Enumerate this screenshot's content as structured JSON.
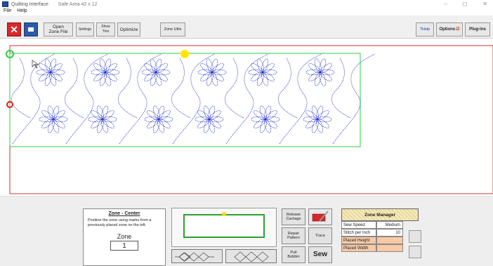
{
  "window": {
    "title": "Quilting Interface",
    "subtitle": "Safe Area 42 x 12",
    "min": "–",
    "max": "◻",
    "close": "✕"
  },
  "menu": [
    "File",
    "Help"
  ],
  "toolbar": {
    "close_glyph": "✕",
    "open_zone": "Open\nZone File",
    "settings": "Settings",
    "show_trim": "Show\nTrim",
    "optimize": "Optimize",
    "zone_utils": "Zone Utils",
    "help": "?Help",
    "options": "Options",
    "plugins": "Plug-ins"
  },
  "zone_info": {
    "title": "Zone - Center",
    "description": "Position the zone using marks from a previously placed zone on the left.",
    "zone_label": "Zone",
    "zone_value": "1"
  },
  "controls": {
    "release_carriage": "Release\nCarriage",
    "repair_pattern": "Repair\nPattern",
    "trace": "Trace",
    "pull_bobbin": "Pull\nBobbin",
    "sew": "Sew"
  },
  "zone_manager": {
    "title": "Zone Manager",
    "rows": [
      {
        "label": "Sew Speed",
        "value": "Medium"
      },
      {
        "label": "Stitch per Inch",
        "value": "10"
      },
      {
        "label": "Placed Height",
        "value": ""
      },
      {
        "label": "Placed Width",
        "value": ""
      }
    ]
  },
  "colors": {
    "canvas_border": "#d32f2f",
    "zone_border": "#2ecc40",
    "stitch": "#2233cc",
    "marker_yellow": "#ffe600",
    "marker_red": "#e01d1d"
  }
}
